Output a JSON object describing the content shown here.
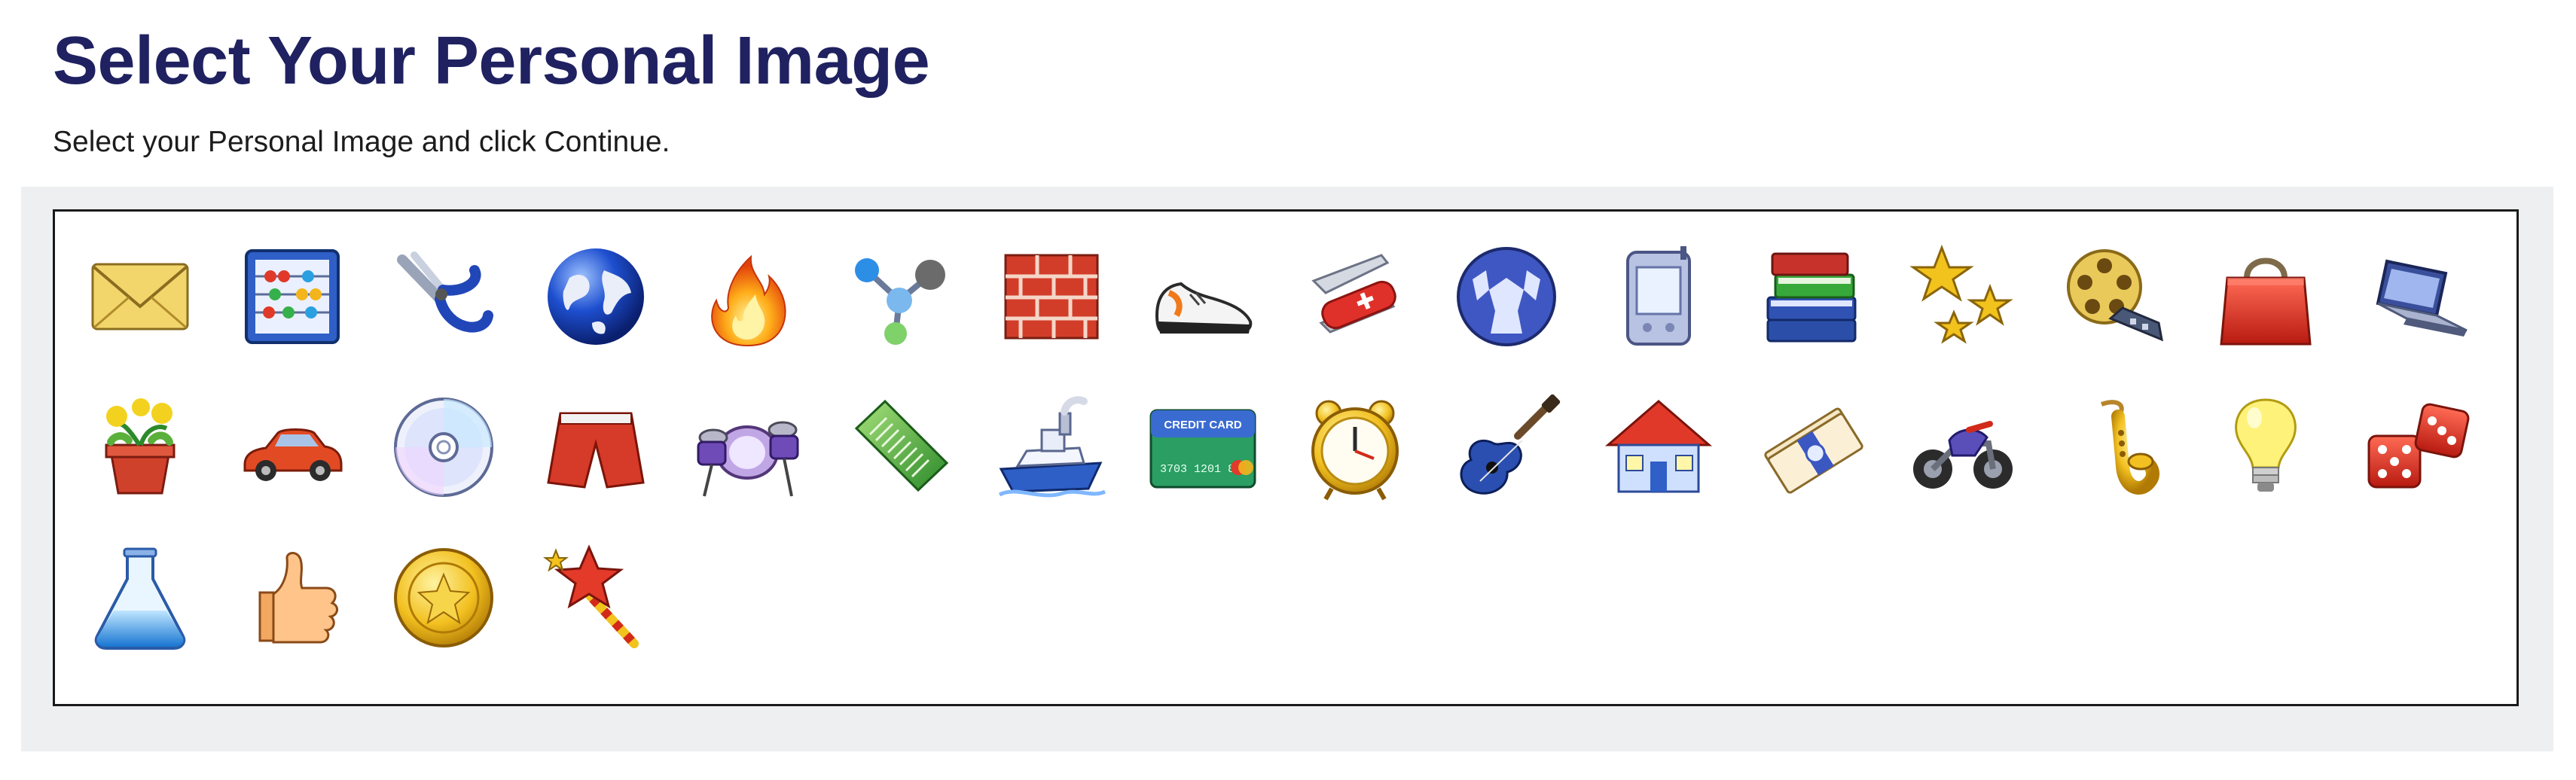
{
  "page": {
    "title": "Select Your Personal Image",
    "instructions": "Select your Personal Image and click Continue."
  },
  "images": [
    {
      "name": "envelope",
      "icon": "envelope-icon"
    },
    {
      "name": "abacus",
      "icon": "abacus-icon"
    },
    {
      "name": "pliers",
      "icon": "pliers-icon"
    },
    {
      "name": "globe",
      "icon": "globe-icon"
    },
    {
      "name": "fire",
      "icon": "fire-icon"
    },
    {
      "name": "molecule",
      "icon": "molecule-icon"
    },
    {
      "name": "brick-wall",
      "icon": "brick-wall-icon"
    },
    {
      "name": "sneaker",
      "icon": "sneaker-icon"
    },
    {
      "name": "pocket-knife",
      "icon": "pocket-knife-icon"
    },
    {
      "name": "soccer-ball",
      "icon": "soccer-ball-icon"
    },
    {
      "name": "pda",
      "icon": "pda-icon"
    },
    {
      "name": "books",
      "icon": "books-icon"
    },
    {
      "name": "stars",
      "icon": "stars-icon"
    },
    {
      "name": "film-reel",
      "icon": "film-reel-icon"
    },
    {
      "name": "shopping-bag",
      "icon": "shopping-bag-icon"
    },
    {
      "name": "laptop",
      "icon": "laptop-icon"
    },
    {
      "name": "flower-pot",
      "icon": "flower-pot-icon"
    },
    {
      "name": "car",
      "icon": "car-icon"
    },
    {
      "name": "cd",
      "icon": "cd-icon"
    },
    {
      "name": "shorts",
      "icon": "shorts-icon"
    },
    {
      "name": "drum-kit",
      "icon": "drum-kit-icon"
    },
    {
      "name": "comb",
      "icon": "comb-icon"
    },
    {
      "name": "ship",
      "icon": "ship-icon"
    },
    {
      "name": "credit-card",
      "icon": "credit-card-icon",
      "text": {
        "title": "CREDIT CARD",
        "number": "3703  1201  8"
      }
    },
    {
      "name": "alarm-clock",
      "icon": "alarm-clock-icon"
    },
    {
      "name": "guitar",
      "icon": "guitar-icon"
    },
    {
      "name": "house",
      "icon": "house-icon"
    },
    {
      "name": "money",
      "icon": "money-icon"
    },
    {
      "name": "motorcycle",
      "icon": "motorcycle-icon"
    },
    {
      "name": "saxophone",
      "icon": "saxophone-icon"
    },
    {
      "name": "light-bulb",
      "icon": "light-bulb-icon"
    },
    {
      "name": "dice",
      "icon": "dice-icon"
    },
    {
      "name": "flask",
      "icon": "flask-icon"
    },
    {
      "name": "thumbs-up",
      "icon": "thumbs-up-icon"
    },
    {
      "name": "gold-coin",
      "icon": "gold-coin-icon"
    },
    {
      "name": "magic-wand",
      "icon": "magic-wand-icon"
    }
  ]
}
